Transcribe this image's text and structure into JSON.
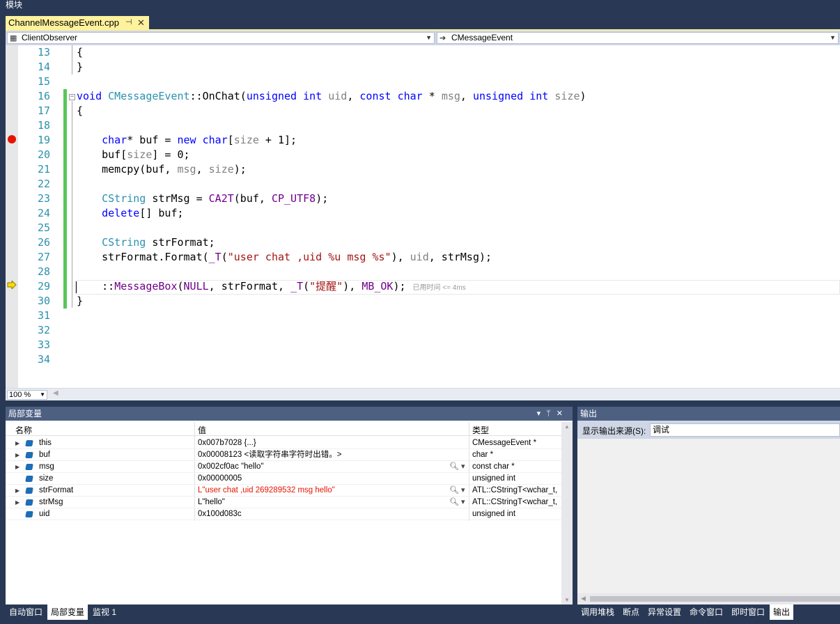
{
  "window": {
    "top_label": "模块"
  },
  "doc_tab": {
    "label": "ChannelMessageEvent.cpp",
    "pin_icon": "pin-icon",
    "close_icon": "close-icon"
  },
  "navbar": {
    "scope": "ClientObserver",
    "member": "CMessageEvent"
  },
  "editor": {
    "lines": [
      {
        "num": "13",
        "html": "{"
      },
      {
        "num": "14",
        "html": "}"
      },
      {
        "num": "15",
        "html": ""
      },
      {
        "num": "16",
        "html": "<span class=\"kw\">void</span> <span class=\"ty\">CMessageEvent</span>::OnChat(<span class=\"kw\">unsigned</span> <span class=\"kw\">int</span> <span class=\"pm\">uid</span>, <span class=\"kw\">const</span> <span class=\"kw\">char</span> * <span class=\"pm\">msg</span>, <span class=\"kw\">unsigned</span> <span class=\"kw\">int</span> <span class=\"pm\">size</span>)"
      },
      {
        "num": "17",
        "html": "{"
      },
      {
        "num": "18",
        "html": ""
      },
      {
        "num": "19",
        "html": "    <span class=\"kw\">char</span>* buf = <span class=\"kw\">new</span> <span class=\"kw\">char</span>[<span class=\"pm\">size</span> + 1];"
      },
      {
        "num": "20",
        "html": "    buf[<span class=\"pm\">size</span>] = 0;"
      },
      {
        "num": "21",
        "html": "    memcpy(buf, <span class=\"pm\">msg</span>, <span class=\"pm\">size</span>);"
      },
      {
        "num": "22",
        "html": ""
      },
      {
        "num": "23",
        "html": "    <span class=\"ty\">CString</span> strMsg = <span class=\"mc\">CA2T</span>(buf, <span class=\"mc\">CP_UTF8</span>);"
      },
      {
        "num": "24",
        "html": "    <span class=\"kw\">delete</span>[] buf;"
      },
      {
        "num": "25",
        "html": ""
      },
      {
        "num": "26",
        "html": "    <span class=\"ty\">CString</span> strFormat;"
      },
      {
        "num": "27",
        "html": "    strFormat.Format(<span class=\"mc\">_T</span>(<span class=\"st\">\"user chat ,uid %u msg %s\"</span>), <span class=\"pm\">uid</span>, strMsg);"
      },
      {
        "num": "28",
        "html": ""
      },
      {
        "num": "29",
        "html": "    ::<span class=\"mc\">MessageBox</span>(<span class=\"mc\">NULL</span>, strFormat, <span class=\"mc\">_T</span>(<span class=\"st\">\"提醒\"</span>), <span class=\"mc\">MB_OK</span>);<span class=\"elapsed\">已用时间 &lt;= 4ms</span>"
      },
      {
        "num": "30",
        "html": "}"
      },
      {
        "num": "31",
        "html": ""
      },
      {
        "num": "32",
        "html": ""
      },
      {
        "num": "33",
        "html": ""
      },
      {
        "num": "34",
        "html": ""
      }
    ],
    "zoom": "100 %",
    "breakpoint_line": "19",
    "current_line": "29",
    "elapsed_text": "已用时间 <= 4ms"
  },
  "locals": {
    "title": "局部变量",
    "columns": {
      "name": "名称",
      "value": "值",
      "type": "类型"
    },
    "rows": [
      {
        "expand": "▶",
        "name": "this",
        "value": "0x007b7028 {...}",
        "type": "CMessageEvent *",
        "changed": false,
        "mag": false
      },
      {
        "expand": "▶",
        "name": "buf",
        "value": "0x00008123 <读取字符串字符时出错。>",
        "type": "char *",
        "changed": false,
        "mag": false
      },
      {
        "expand": "▶",
        "name": "msg",
        "value": "0x002cf0ac \"hello\"",
        "type": "const char *",
        "changed": false,
        "mag": true
      },
      {
        "expand": "",
        "name": "size",
        "value": "0x00000005",
        "type": "unsigned int",
        "changed": false,
        "mag": false
      },
      {
        "expand": "▶",
        "name": "strFormat",
        "value": "L\"user chat ,uid 269289532 msg hello\"",
        "type": "ATL::CStringT<wchar_t,",
        "changed": true,
        "mag": true
      },
      {
        "expand": "▶",
        "name": "strMsg",
        "value": "L\"hello\"",
        "type": "ATL::CStringT<wchar_t,",
        "changed": false,
        "mag": true
      },
      {
        "expand": "",
        "name": "uid",
        "value": "0x100d083c",
        "type": "unsigned int",
        "changed": false,
        "mag": false
      }
    ]
  },
  "output": {
    "title": "输出",
    "source_label": "显示输出来源(S):",
    "source_value": "调试"
  },
  "bottom_tabs_left": [
    {
      "label": "自动窗口",
      "active": false
    },
    {
      "label": "局部变量",
      "active": true
    },
    {
      "label": "监视 1",
      "active": false
    }
  ],
  "bottom_tabs_right": [
    {
      "label": "调用堆栈",
      "active": false
    },
    {
      "label": "断点",
      "active": false
    },
    {
      "label": "异常设置",
      "active": false
    },
    {
      "label": "命令窗口",
      "active": false
    },
    {
      "label": "即时窗口",
      "active": false
    },
    {
      "label": "输出",
      "active": true
    }
  ],
  "colors": {
    "accent_tab": "#fff29d",
    "frame": "#293955",
    "panel_title": "#4d6082",
    "breakpoint": "#e51400",
    "change_bar": "#57c75a"
  }
}
